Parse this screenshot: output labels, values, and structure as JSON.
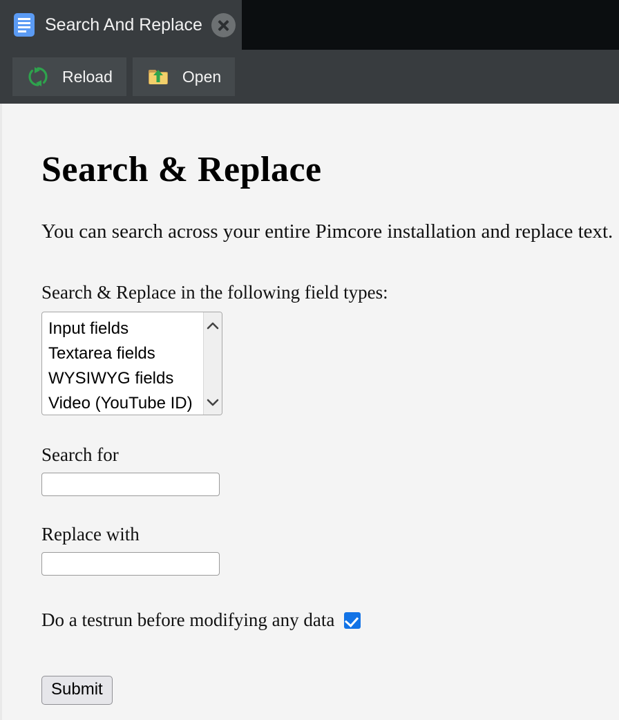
{
  "browser": {
    "tab": {
      "favicon": "document-icon",
      "title": "Search And Replace",
      "close_label": "✕"
    },
    "toolbar": {
      "buttons": [
        {
          "icon": "reload-icon",
          "label": "Reload"
        },
        {
          "icon": "folder-open-icon",
          "label": "Open"
        }
      ]
    },
    "colors": {
      "tabstrip_bg": "#0b0e10",
      "tab_bg": "#383c3f",
      "toolbar_bg": "#383c3f",
      "toolbar_button_bg": "#44494c",
      "tab_text": "#f2f2f2",
      "favicon_blue": "#5b9bf4",
      "reload_green": "#2ea34d",
      "folder_yellow": "#f2d06b"
    }
  },
  "page": {
    "title": "Search & Replace",
    "intro": "You can search across your entire Pimcore installation and replace text.",
    "fieldtypes": {
      "label": "Search & Replace in the following field types:",
      "options": [
        "Input fields",
        "Textarea fields",
        "WYSIWYG fields",
        "Video (YouTube ID)"
      ],
      "scroll_up": "⌃",
      "scroll_down": "⌄"
    },
    "search_for": {
      "label": "Search for",
      "value": "",
      "placeholder": ""
    },
    "replace_with": {
      "label": "Replace with",
      "value": "",
      "placeholder": ""
    },
    "testrun": {
      "label": "Do a testrun before modifying any data",
      "checked": true,
      "checkbox_color": "#1273e6"
    },
    "submit": {
      "label": "Submit"
    },
    "colors": {
      "background": "#f4f4f4",
      "text": "#111111"
    }
  }
}
